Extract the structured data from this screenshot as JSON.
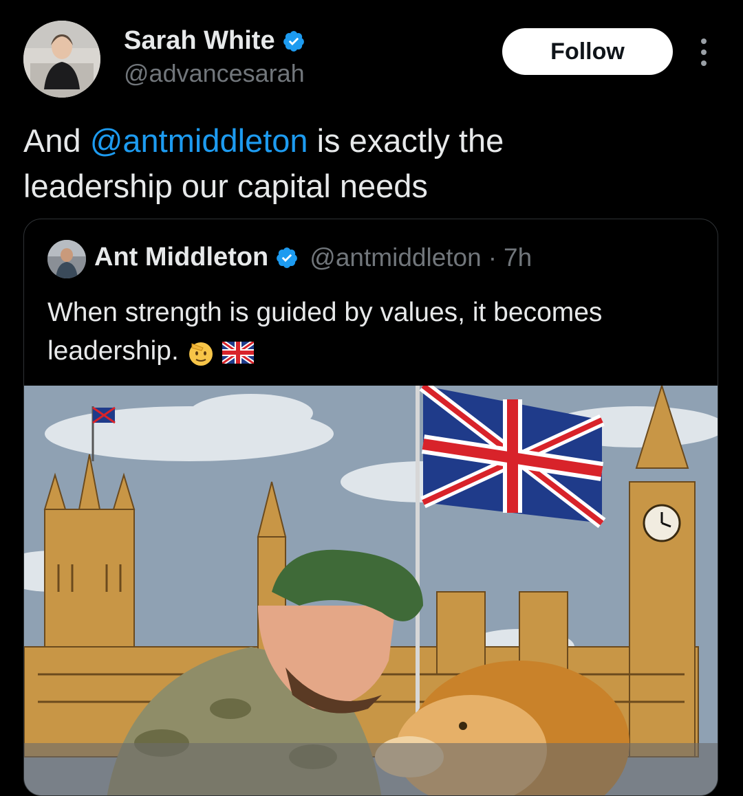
{
  "author": {
    "name": "Sarah White",
    "handle": "@advancesarah",
    "verified": true
  },
  "follow_button": {
    "label": "Follow"
  },
  "more_menu": {
    "icon": "more-vertical-icon"
  },
  "tweet": {
    "prefix": "And ",
    "mention": "@antmiddleton",
    "line1_rest": " is exactly the",
    "line2": "leadership our capital needs"
  },
  "quoted_tweet": {
    "name": "Ant Middleton",
    "handle": "@antmiddleton",
    "separator": "·",
    "time": "7h",
    "line1": "When strength is guided by values, it becomes",
    "line2": "leadership.",
    "emojis": [
      "saluting-face-emoji",
      "uk-flag-emoji"
    ],
    "image": "illustration-soldier-with-lion-at-westminster"
  },
  "colors": {
    "background": "#000000",
    "text": "#e7e9ea",
    "secondary": "#71767b",
    "accent": "#1d9bf0"
  }
}
